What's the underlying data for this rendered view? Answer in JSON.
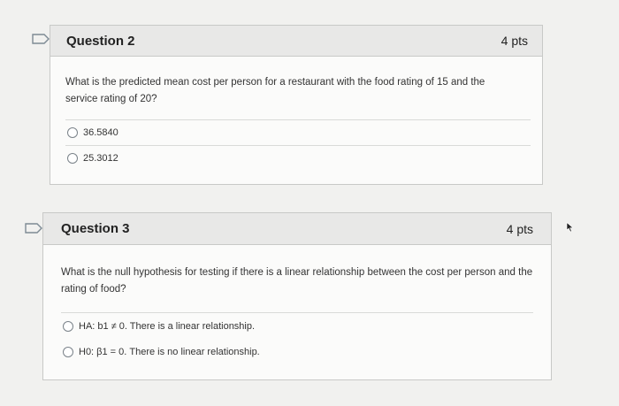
{
  "questions": [
    {
      "title": "Question 2",
      "points": "4 pts",
      "text": "What is the predicted mean cost per person for a restaurant with the food rating of 15 and the service rating of 20?",
      "answers": [
        "36.5840",
        "25.3012"
      ]
    },
    {
      "title": "Question 3",
      "points": "4 pts",
      "text": "What is the null hypothesis for testing if there is a linear relationship between the cost per person and the rating of food?",
      "answers": [
        "HA: b1 ≠ 0. There is a linear relationship.",
        "H0: β1 = 0. There is no linear relationship."
      ]
    }
  ],
  "icons": {
    "flag": "flag-icon",
    "cursor": "mouse-pointer-icon"
  },
  "colors": {
    "flag_stroke": "#7d8a94",
    "header_bg": "#e8e8e7",
    "card_bg": "#fbfbfa"
  }
}
